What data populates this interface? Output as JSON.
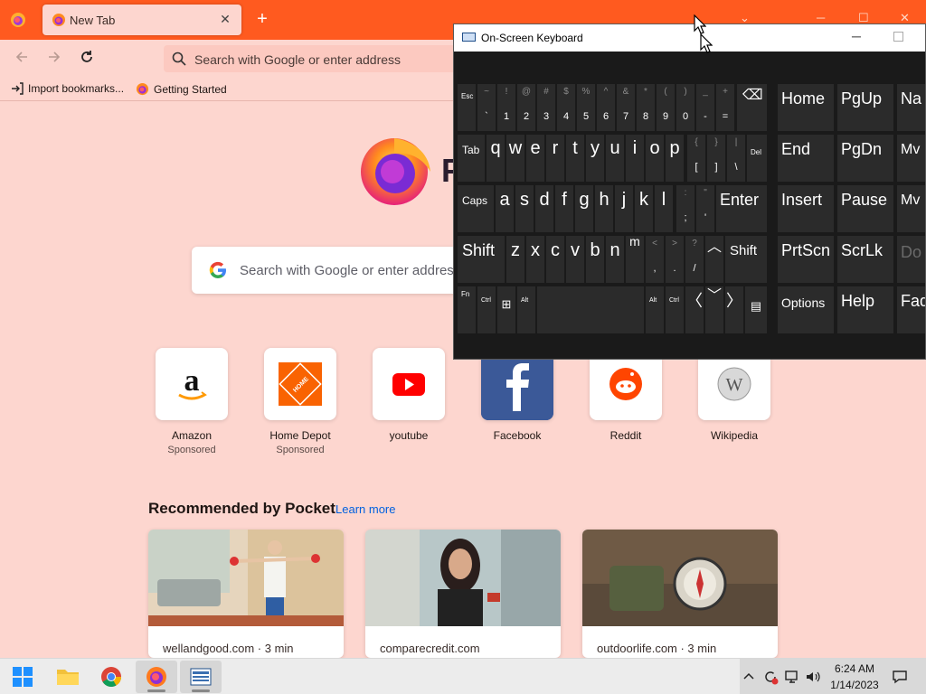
{
  "browser": {
    "tab_title": "New Tab",
    "tab_close": "✕",
    "new_tab": "+",
    "url_placeholder": "Search with Google or enter address",
    "bookmarks": [
      "Import bookmarks...",
      "Getting Started"
    ]
  },
  "newtab": {
    "wordmark": "F",
    "search_placeholder": "Search with Google or enter address",
    "sites": [
      {
        "name": "Amazon",
        "label": "Sponsored"
      },
      {
        "name": "Home Depot",
        "label": "Sponsored"
      },
      {
        "name": "youtube",
        "label": ""
      },
      {
        "name": "Facebook",
        "label": ""
      },
      {
        "name": "Reddit",
        "label": ""
      },
      {
        "name": "Wikipedia",
        "label": ""
      }
    ],
    "pocket_title": "Recommended by Pocket",
    "pocket_learn": "Learn more",
    "cards": [
      {
        "source": "wellandgood.com · 3 min"
      },
      {
        "source": "comparecredit.com"
      },
      {
        "source": "outdoorlife.com · 3 min"
      }
    ]
  },
  "osk": {
    "title": "On-Screen Keyboard",
    "keys": {
      "esc": "Esc",
      "tab": "Tab",
      "caps": "Caps",
      "shift": "Shift",
      "fn": "Fn",
      "ctrl": "Ctrl",
      "alt": "Alt",
      "enter": "Enter",
      "del": "Del",
      "home": "Home",
      "pgup": "PgUp",
      "na": "Na",
      "end": "End",
      "pgdn": "PgDn",
      "mv1": "Mv",
      "insert": "Insert",
      "pause": "Pause",
      "mv2": "Mv",
      "prtscn": "PrtScn",
      "scrlk": "ScrLk",
      "do": "Do",
      "options": "Options",
      "help": "Help",
      "fad": "Fad",
      "row1": [
        [
          "~",
          "`"
        ],
        [
          "!",
          "1"
        ],
        [
          "@",
          "2"
        ],
        [
          "#",
          "3"
        ],
        [
          "$",
          "4"
        ],
        [
          "%",
          "5"
        ],
        [
          "^",
          "6"
        ],
        [
          "&",
          "7"
        ],
        [
          "*",
          "8"
        ],
        [
          "(",
          "9"
        ],
        [
          ")",
          "0"
        ],
        [
          "_",
          "-"
        ],
        [
          "+",
          "="
        ]
      ],
      "row2": [
        "q",
        "w",
        "e",
        "r",
        "t",
        "y",
        "u",
        "i",
        "o",
        "p"
      ],
      "row2sym": [
        [
          "{",
          "["
        ],
        [
          "}",
          "]"
        ],
        [
          "|",
          "\\"
        ]
      ],
      "row3": [
        "a",
        "s",
        "d",
        "f",
        "g",
        "h",
        "j",
        "k",
        "l"
      ],
      "row3sym": [
        [
          ":",
          ";"
        ],
        [
          "\"",
          "'"
        ]
      ],
      "row4": [
        "z",
        "x",
        "c",
        "v",
        "b",
        "n",
        "m"
      ],
      "row4sym": [
        [
          "<",
          ","
        ],
        [
          ">",
          "."
        ],
        [
          "?",
          "/"
        ]
      ]
    }
  },
  "taskbar": {
    "time": "6:24 AM",
    "date": "1/14/2023"
  }
}
